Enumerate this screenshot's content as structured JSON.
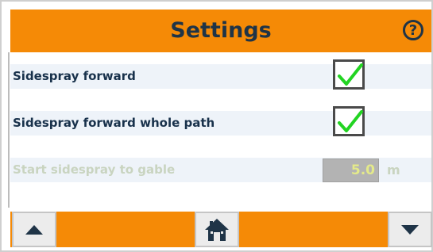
{
  "header": {
    "title": "Settings",
    "help_glyph": "?",
    "color": "#f58a06"
  },
  "settings": [
    {
      "label": "Sidespray forward",
      "checked": true,
      "enabled": true
    },
    {
      "label": "Sidespray forward whole path",
      "checked": true,
      "enabled": true
    },
    {
      "label": "Start sidespray to gable",
      "value": "5.0",
      "unit": "m",
      "enabled": false
    }
  ],
  "footer": {
    "buttons": [
      {
        "name": "up",
        "icon": "arrow-up-icon"
      },
      {
        "name": "home",
        "icon": "home-icon"
      },
      {
        "name": "down",
        "icon": "arrow-down-icon"
      }
    ]
  },
  "colors": {
    "accent": "#f58a06",
    "text": "#18314b",
    "check": "#22d422",
    "row_bg": "#eef3f9"
  }
}
